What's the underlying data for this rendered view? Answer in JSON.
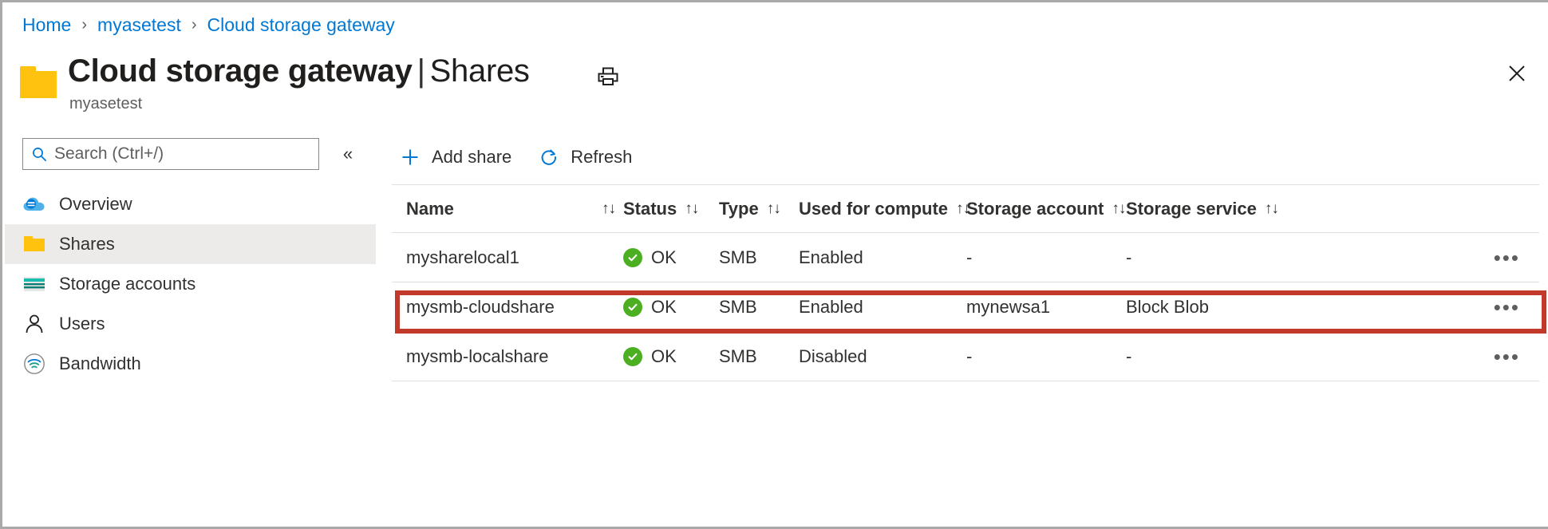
{
  "breadcrumb": {
    "items": [
      {
        "label": "Home"
      },
      {
        "label": "myasetest"
      },
      {
        "label": "Cloud storage gateway"
      }
    ],
    "separator": "›"
  },
  "header": {
    "icon": "folder-icon",
    "title": "Cloud storage gateway",
    "title_separator": "|",
    "title_section": "Shares",
    "subtitle": "myasetest",
    "print_icon": "print-icon",
    "close_icon": "close-icon"
  },
  "sidebar": {
    "search": {
      "placeholder": "Search (Ctrl+/)",
      "value": "",
      "icon": "search-icon"
    },
    "collapse_icon": "«",
    "items": [
      {
        "label": "Overview",
        "icon": "cloud-icon",
        "selected": false
      },
      {
        "label": "Shares",
        "icon": "folder-icon",
        "selected": true
      },
      {
        "label": "Storage accounts",
        "icon": "storage-account-icon",
        "selected": false
      },
      {
        "label": "Users",
        "icon": "user-icon",
        "selected": false
      },
      {
        "label": "Bandwidth",
        "icon": "bandwidth-icon",
        "selected": false
      }
    ]
  },
  "toolbar": {
    "add_share_label": "Add share",
    "add_share_icon": "plus-icon",
    "refresh_label": "Refresh",
    "refresh_icon": "refresh-icon"
  },
  "table": {
    "sort_glyph": "↑↓",
    "columns": [
      {
        "key": "name",
        "label": "Name"
      },
      {
        "key": "status",
        "label": "Status"
      },
      {
        "key": "type",
        "label": "Type"
      },
      {
        "key": "compute",
        "label": "Used for compute"
      },
      {
        "key": "account",
        "label": "Storage account"
      },
      {
        "key": "service",
        "label": "Storage service"
      }
    ],
    "rows": [
      {
        "name": "mysharelocal1",
        "status": "OK",
        "status_icon": "check-circle-icon",
        "type": "SMB",
        "compute": "Enabled",
        "account": "-",
        "service": "-",
        "more": "•••"
      },
      {
        "name": "mysmb-cloudshare",
        "status": "OK",
        "status_icon": "check-circle-icon",
        "type": "SMB",
        "compute": "Enabled",
        "account": "mynewsa1",
        "service": "Block Blob",
        "more": "•••",
        "highlighted": true
      },
      {
        "name": "mysmb-localshare",
        "status": "OK",
        "status_icon": "check-circle-icon",
        "type": "SMB",
        "compute": "Disabled",
        "account": "-",
        "service": "-",
        "more": "•••"
      }
    ]
  },
  "annotation": {
    "highlight_color": "#c0392b",
    "target_row": "mysmb-cloudshare"
  },
  "colors": {
    "link": "#0078d4",
    "accent": "#0078d4",
    "folder_yellow": "#ffc20e",
    "status_green": "#4caf22",
    "selected_row_bg": "#edebe9"
  }
}
